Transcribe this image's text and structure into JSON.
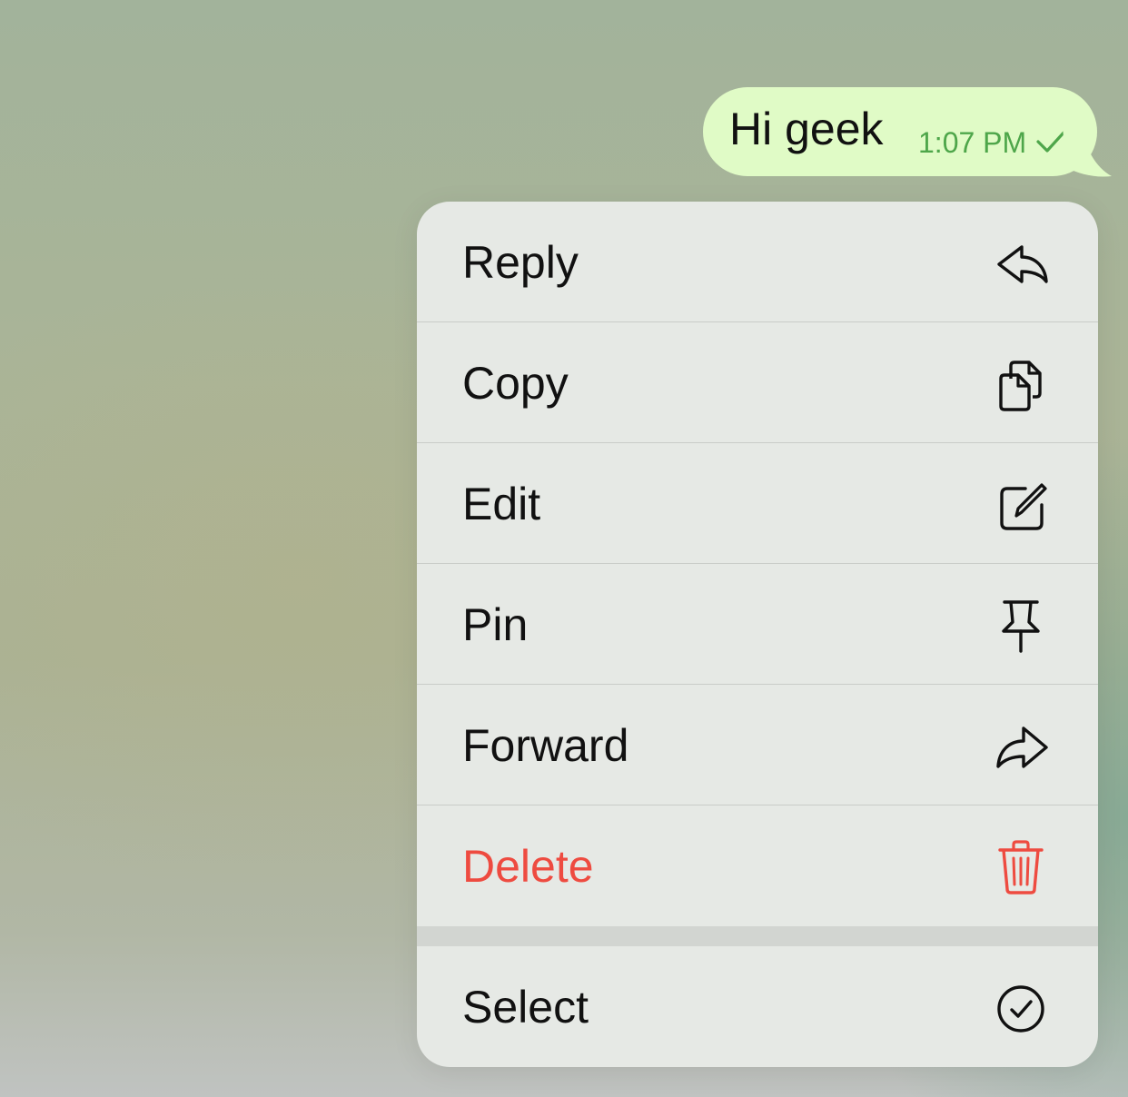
{
  "message": {
    "text": "Hi geek",
    "time": "1:07 PM",
    "status_icon": "checkmark-icon"
  },
  "menu": {
    "items": [
      {
        "label": "Reply",
        "icon": "reply-icon"
      },
      {
        "label": "Copy",
        "icon": "copy-icon"
      },
      {
        "label": "Edit",
        "icon": "edit-icon"
      },
      {
        "label": "Pin",
        "icon": "pin-icon"
      },
      {
        "label": "Forward",
        "icon": "forward-icon"
      },
      {
        "label": "Delete",
        "icon": "trash-icon",
        "color": "#ee4b40"
      },
      {
        "label": "Select",
        "icon": "select-circle-check-icon"
      }
    ]
  },
  "colors": {
    "bubble": "#e0fbc6",
    "time_text": "#4ea64a",
    "danger": "#ee4b40"
  }
}
